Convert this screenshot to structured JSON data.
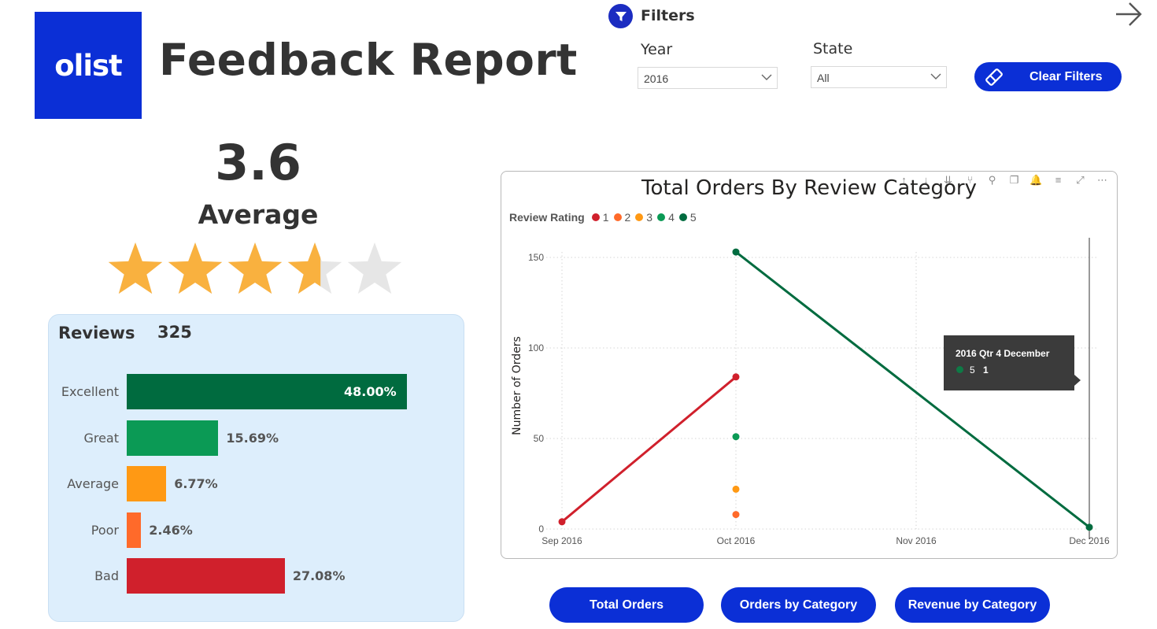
{
  "header": {
    "logo_text": "olist",
    "title": "Feedback Report"
  },
  "filters": {
    "label": "Filters",
    "year": {
      "label": "Year",
      "value": "2016"
    },
    "state": {
      "label": "State",
      "value": "All"
    },
    "clear_label": "Clear Filters"
  },
  "summary": {
    "average_value": "3.6",
    "average_label": "Average",
    "stars_rating": 3.6,
    "stars_total": 5,
    "star_color": "#F9B13F",
    "star_empty_color": "#E6E6E6"
  },
  "reviews": {
    "label": "Reviews",
    "count": "325",
    "rows": [
      {
        "label": "Excellent",
        "value": 48.0,
        "pct": "48.00%",
        "color": "#006B3F"
      },
      {
        "label": "Great",
        "value": 15.69,
        "pct": "15.69%",
        "color": "#0B9A55"
      },
      {
        "label": "Average",
        "value": 6.77,
        "pct": "6.77%",
        "color": "#FF9914"
      },
      {
        "label": "Poor",
        "value": 2.46,
        "pct": "2.46%",
        "color": "#FF6A2A"
      },
      {
        "label": "Bad",
        "value": 27.08,
        "pct": "27.08%",
        "color": "#D0202C"
      }
    ]
  },
  "chart_data": {
    "type": "line",
    "title": "Total Orders By Review Category",
    "legend_title": "Review Rating",
    "ylabel": "Number of Orders",
    "xlabel": "",
    "categories": [
      "Sep 2016",
      "Oct 2016",
      "Nov 2016",
      "Dec 2016"
    ],
    "ylim": [
      0,
      160
    ],
    "yticks": [
      0,
      50,
      100,
      150
    ],
    "grid": true,
    "legend_position": "top-left",
    "series": [
      {
        "name": "1",
        "color": "#D0202C",
        "values": [
          4,
          84,
          null,
          null
        ]
      },
      {
        "name": "2",
        "color": "#FF6A2A",
        "values": [
          null,
          8,
          null,
          null
        ]
      },
      {
        "name": "3",
        "color": "#FF9914",
        "values": [
          null,
          22,
          null,
          null
        ]
      },
      {
        "name": "4",
        "color": "#0B9A55",
        "values": [
          null,
          51,
          null,
          null
        ]
      },
      {
        "name": "5",
        "color": "#006B3F",
        "values": [
          null,
          153,
          null,
          1
        ]
      }
    ]
  },
  "chart_toolbar": [
    "↑",
    "↓",
    "⇊",
    "⑂",
    "⚲",
    "❐",
    "🔔",
    "≡",
    "⤢",
    "⋯"
  ],
  "tooltip": {
    "title": "2016 Qtr 4 December",
    "series": "5",
    "value": "1"
  },
  "nav": {
    "total_orders": "Total Orders",
    "orders_by_category": "Orders by Category",
    "revenue_by_category": "Revenue by Category"
  }
}
